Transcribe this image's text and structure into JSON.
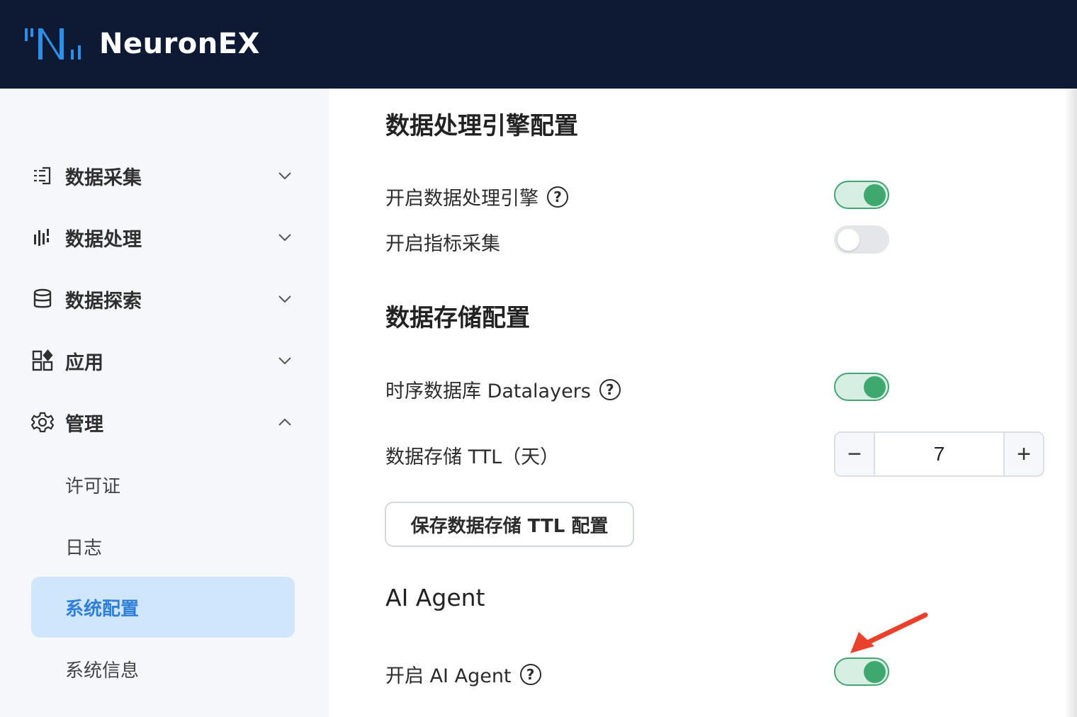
{
  "header": {
    "brand": "NeuronEX"
  },
  "sidebar": {
    "groups": [
      {
        "label": "数据采集",
        "icon": "data-collect-icon",
        "expanded": false
      },
      {
        "label": "数据处理",
        "icon": "data-process-icon",
        "expanded": false
      },
      {
        "label": "数据探索",
        "icon": "database-icon",
        "expanded": false
      },
      {
        "label": "应用",
        "icon": "apps-icon",
        "expanded": false
      },
      {
        "label": "管理",
        "icon": "gear-icon",
        "expanded": true
      }
    ],
    "sub_items": [
      {
        "label": "许可证",
        "active": false
      },
      {
        "label": "日志",
        "active": false
      },
      {
        "label": "系统配置",
        "active": true
      },
      {
        "label": "系统信息",
        "active": false
      }
    ]
  },
  "main": {
    "engine_section": {
      "title": "数据处理引擎配置",
      "enable_engine_label": "开启数据处理引擎",
      "enable_engine": true,
      "enable_metrics_label": "开启指标采集",
      "enable_metrics": false
    },
    "storage_section": {
      "title": "数据存储配置",
      "datalayers_label": "时序数据库 Datalayers",
      "datalayers_enabled": true,
      "ttl_label": "数据存储 TTL（天）",
      "ttl_value": "7",
      "save_button": "保存数据存储 TTL 配置"
    },
    "ai_section": {
      "title": "AI Agent",
      "enable_ai_label": "开启 AI Agent",
      "enable_ai": true
    },
    "help_glyph": "?",
    "stepper_minus": "−",
    "stepper_plus": "+"
  },
  "colors": {
    "header_bg": "#0e1a33",
    "switch_on": "#3fa86f",
    "active_nav_bg": "#cfe6fd",
    "active_nav_text": "#2f7fd6",
    "annotation_arrow": "#e8412c"
  }
}
